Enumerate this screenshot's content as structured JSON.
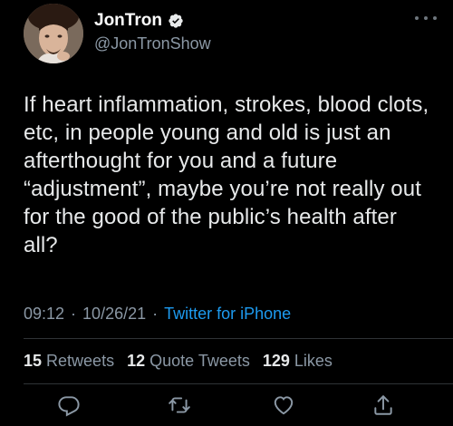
{
  "author": {
    "display_name": "JonTron",
    "handle": "@JonTronShow",
    "avatar_icon": "profile-photo",
    "verified_icon": "verified-badge-icon",
    "verified_color": "#e7e9ea"
  },
  "tweet": {
    "text": "If heart inflammation, strokes, blood clots, etc, in people young and old is just an afterthought for you and a future “adjustment”, maybe you’re not really out for the good of the public’s health after all?"
  },
  "meta": {
    "time": "09:12",
    "separator": "·",
    "date": "10/26/21",
    "source": "Twitter for iPhone",
    "source_color": "#1d9bf0"
  },
  "stats": {
    "retweets_count": "15",
    "retweets_label": "Retweets",
    "quotes_count": "12",
    "quotes_label": "Quote Tweets",
    "likes_count": "129",
    "likes_label": "Likes"
  },
  "actions": [
    {
      "name": "reply",
      "icon": "reply-icon"
    },
    {
      "name": "retweet",
      "icon": "retweet-icon"
    },
    {
      "name": "like",
      "icon": "heart-icon"
    },
    {
      "name": "share",
      "icon": "share-icon"
    }
  ],
  "more_icon": "more-options-icon"
}
